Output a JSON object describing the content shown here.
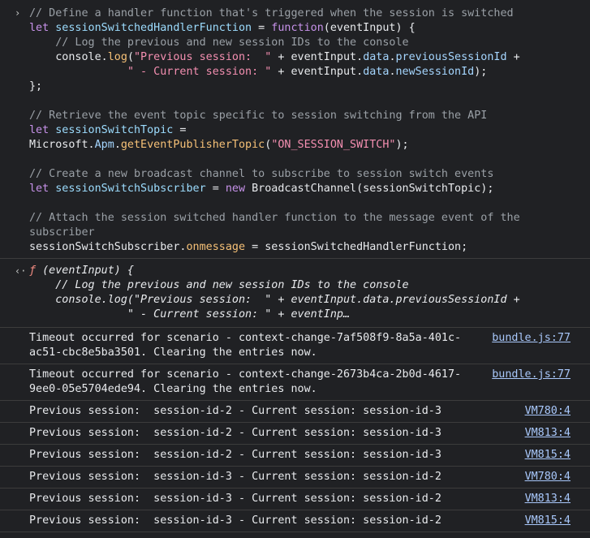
{
  "input": {
    "prompt_glyph": "›",
    "lines": [
      [
        {
          "c": "cm",
          "t": "// Define a handler function that's triggered when the session is switched"
        }
      ],
      [
        {
          "c": "kw",
          "t": "let "
        },
        {
          "c": "id",
          "t": "sessionSwitchedHandlerFunction"
        },
        {
          "c": "plain",
          "t": " = "
        },
        {
          "c": "kw",
          "t": "function"
        },
        {
          "c": "plain",
          "t": "(eventInput) {"
        }
      ],
      [
        {
          "c": "plain",
          "t": "    "
        },
        {
          "c": "cm",
          "t": "// Log the previous and new session IDs to the console"
        }
      ],
      [
        {
          "c": "plain",
          "t": "    console."
        },
        {
          "c": "fn",
          "t": "log"
        },
        {
          "c": "plain",
          "t": "("
        },
        {
          "c": "str",
          "t": "\"Previous session:  \""
        },
        {
          "c": "plain",
          "t": " + eventInput."
        },
        {
          "c": "prop",
          "t": "data"
        },
        {
          "c": "plain",
          "t": "."
        },
        {
          "c": "prop",
          "t": "previousSessionId"
        },
        {
          "c": "plain",
          "t": " +"
        }
      ],
      [
        {
          "c": "plain",
          "t": "               "
        },
        {
          "c": "str",
          "t": "\" - Current session: \""
        },
        {
          "c": "plain",
          "t": " + eventInput."
        },
        {
          "c": "prop",
          "t": "data"
        },
        {
          "c": "plain",
          "t": "."
        },
        {
          "c": "prop",
          "t": "newSessionId"
        },
        {
          "c": "plain",
          "t": ");"
        }
      ],
      [
        {
          "c": "plain",
          "t": "};"
        }
      ],
      [
        {
          "c": "plain",
          "t": ""
        }
      ],
      [
        {
          "c": "cm",
          "t": "// Retrieve the event topic specific to session switching from the API"
        }
      ],
      [
        {
          "c": "kw",
          "t": "let "
        },
        {
          "c": "id",
          "t": "sessionSwitchTopic"
        },
        {
          "c": "plain",
          "t": " ="
        }
      ],
      [
        {
          "c": "plain",
          "t": "Microsoft."
        },
        {
          "c": "prop",
          "t": "Apm"
        },
        {
          "c": "plain",
          "t": "."
        },
        {
          "c": "fn",
          "t": "getEventPublisherTopic"
        },
        {
          "c": "plain",
          "t": "("
        },
        {
          "c": "str",
          "t": "\"ON_SESSION_SWITCH\""
        },
        {
          "c": "plain",
          "t": ");"
        }
      ],
      [
        {
          "c": "plain",
          "t": ""
        }
      ],
      [
        {
          "c": "cm",
          "t": "// Create a new broadcast channel to subscribe to session switch events"
        }
      ],
      [
        {
          "c": "kw",
          "t": "let "
        },
        {
          "c": "id",
          "t": "sessionSwitchSubscriber"
        },
        {
          "c": "plain",
          "t": " = "
        },
        {
          "c": "kw",
          "t": "new "
        },
        {
          "c": "plain",
          "t": "BroadcastChannel(sessionSwitchTopic);"
        }
      ],
      [
        {
          "c": "plain",
          "t": ""
        }
      ],
      [
        {
          "c": "cm",
          "t": "// Attach the session switched handler function to the message event of the"
        }
      ],
      [
        {
          "c": "cm",
          "t": "subscriber"
        }
      ],
      [
        {
          "c": "plain",
          "t": "sessionSwitchSubscriber."
        },
        {
          "c": "fn",
          "t": "onmessage"
        },
        {
          "c": "plain",
          "t": " = sessionSwitchedHandlerFunction;"
        }
      ]
    ]
  },
  "result": {
    "return_glyph": "‹·",
    "f_symbol": "ƒ",
    "lines": [
      [
        {
          "c": "plain",
          "t": " (eventInput) {"
        }
      ],
      [
        {
          "c": "plain",
          "t": "    "
        },
        {
          "c": "plain",
          "t": "// Log the previous and new session IDs to the console"
        }
      ],
      [
        {
          "c": "plain",
          "t": "    console.log("
        },
        {
          "c": "plain",
          "t": "\"Previous session:  \""
        },
        {
          "c": "plain",
          "t": " + eventInput.data.previousSessionId +"
        }
      ],
      [
        {
          "c": "plain",
          "t": "               "
        },
        {
          "c": "plain",
          "t": "\" - Current session: \""
        },
        {
          "c": "plain",
          "t": " + eventInp…"
        }
      ]
    ]
  },
  "logs": [
    {
      "message": "Timeout occurred for scenario - context-change-7af508f9-8a5a-401c-ac51-cbc8e5ba3501. Clearing the entries now.",
      "source": "bundle.js:77"
    },
    {
      "message": "Timeout occurred for scenario - context-change-2673b4ca-2b0d-4617-9ee0-05e5704ede94. Clearing the entries now.",
      "source": "bundle.js:77"
    },
    {
      "message": "Previous session:  session-id-2 - Current session: session-id-3",
      "source": "VM780:4"
    },
    {
      "message": "Previous session:  session-id-2 - Current session: session-id-3",
      "source": "VM813:4"
    },
    {
      "message": "Previous session:  session-id-2 - Current session: session-id-3",
      "source": "VM815:4"
    },
    {
      "message": "Previous session:  session-id-3 - Current session: session-id-2",
      "source": "VM780:4"
    },
    {
      "message": "Previous session:  session-id-3 - Current session: session-id-2",
      "source": "VM813:4"
    },
    {
      "message": "Previous session:  session-id-3 - Current session: session-id-2",
      "source": "VM815:4"
    }
  ]
}
